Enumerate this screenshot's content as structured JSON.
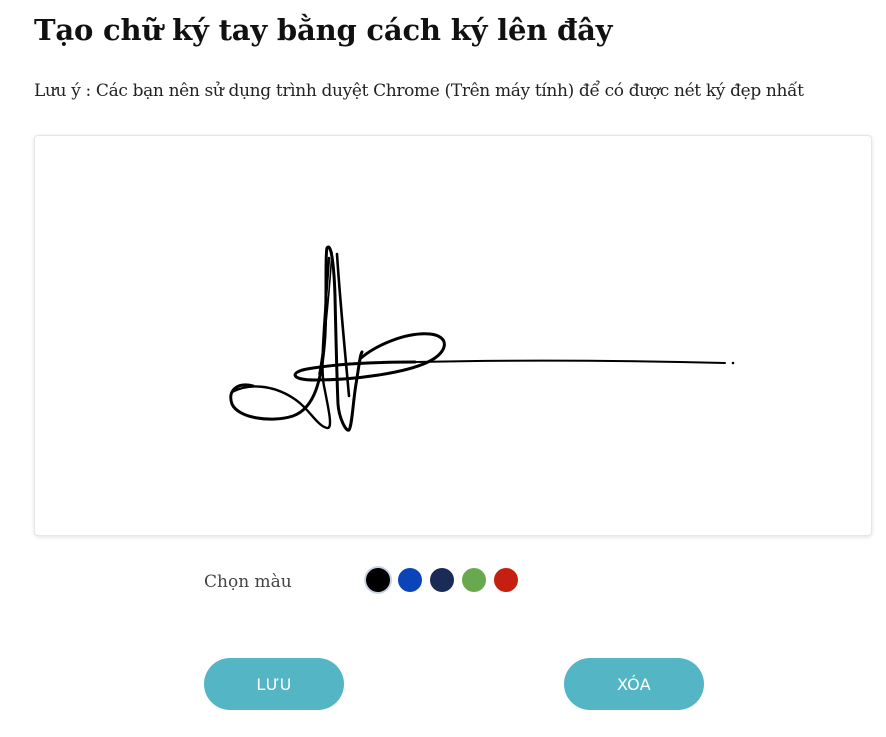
{
  "header": {
    "title": "Tạo chữ ký tay bằng cách ký lên đây",
    "note": "Lưu ý : Các bạn nên sử dụng trình duyệt Chrome (Trên máy tính) để có được nét ký đẹp nhất"
  },
  "signature_pad": {
    "stroke_color": "#000000"
  },
  "color_picker": {
    "label": "Chọn màu",
    "selected": "black",
    "colors": [
      {
        "name": "black",
        "hex": "#000000"
      },
      {
        "name": "blue",
        "hex": "#0b44b8"
      },
      {
        "name": "navy",
        "hex": "#1a2b55"
      },
      {
        "name": "green",
        "hex": "#6aa84f"
      },
      {
        "name": "red",
        "hex": "#c41f10"
      }
    ]
  },
  "actions": {
    "save_label": "LƯU",
    "clear_label": "XÓA",
    "button_color": "#54b6c4"
  }
}
